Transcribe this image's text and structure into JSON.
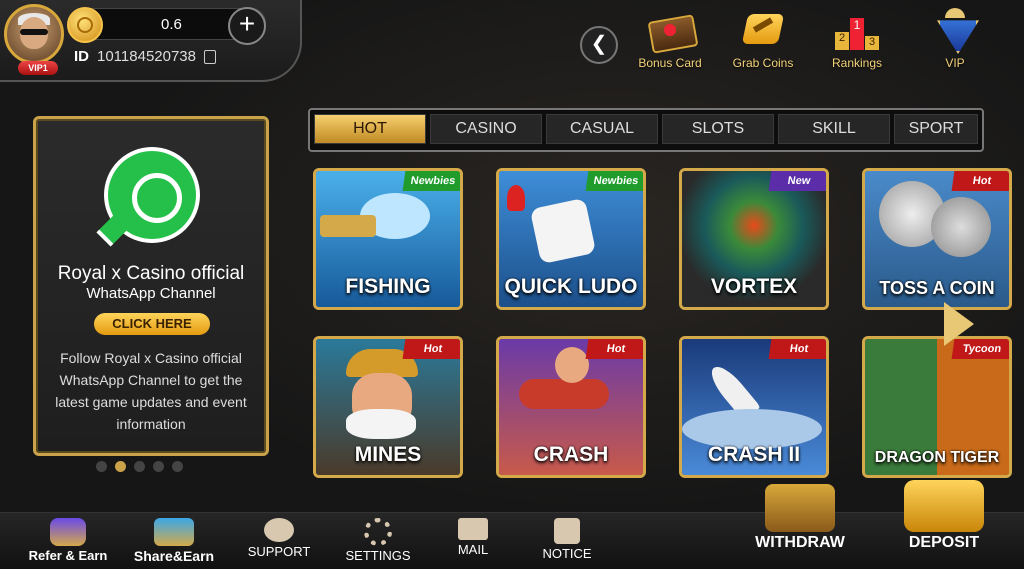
{
  "header": {
    "balance": "0.6",
    "vip_label": "VIP1",
    "id_label": "ID",
    "id_value": "101184520738"
  },
  "top_icons": [
    {
      "label": "Bonus Card",
      "icon": "bonus-card-icon"
    },
    {
      "label": "Grab Coins",
      "icon": "grab-coins-icon"
    },
    {
      "label": "Rankings",
      "icon": "rankings-icon"
    },
    {
      "label": "VIP",
      "icon": "vip-icon"
    }
  ],
  "promo": {
    "title": "Royal x Casino official",
    "subtitle": "WhatsApp Channel",
    "button": "CLICK HERE",
    "description": "Follow Royal x Casino official  WhatsApp Channel to get the latest game updates and event information"
  },
  "tabs": [
    "HOT",
    "CASINO",
    "CASUAL",
    "SLOTS",
    "SKILL",
    "SPORT"
  ],
  "games": [
    {
      "name": "FISHING",
      "badge": "Newbies"
    },
    {
      "name": "QUICK LUDO",
      "badge": "Newbies"
    },
    {
      "name": "VORTEX",
      "badge": "New"
    },
    {
      "name": "TOSS A COIN",
      "badge": "Hot"
    },
    {
      "name": "MINES",
      "badge": "Hot"
    },
    {
      "name": "CRASH",
      "badge": "Hot"
    },
    {
      "name": "CRASH II",
      "badge": "Hot"
    },
    {
      "name": "DRAGON TIGER",
      "badge": "Tycoon"
    }
  ],
  "bottom_nav": [
    {
      "label": "Refer & Earn",
      "icon": "refer-icon"
    },
    {
      "label": "Share&Earn",
      "icon": "share-icon"
    },
    {
      "label": "SUPPORT",
      "icon": "support-icon"
    },
    {
      "label": "SETTINGS",
      "icon": "settings-icon"
    },
    {
      "label": "MAIL",
      "icon": "mail-icon"
    },
    {
      "label": "NOTICE",
      "icon": "notice-icon"
    },
    {
      "label": "WITHDRAW",
      "icon": "withdraw-icon"
    },
    {
      "label": "DEPOSIT",
      "icon": "deposit-icon"
    }
  ],
  "colors": {
    "gold": "#d4a94a",
    "accent": "#f5cf6e",
    "hot": "#c01818",
    "whatsapp": "#25c04a"
  }
}
